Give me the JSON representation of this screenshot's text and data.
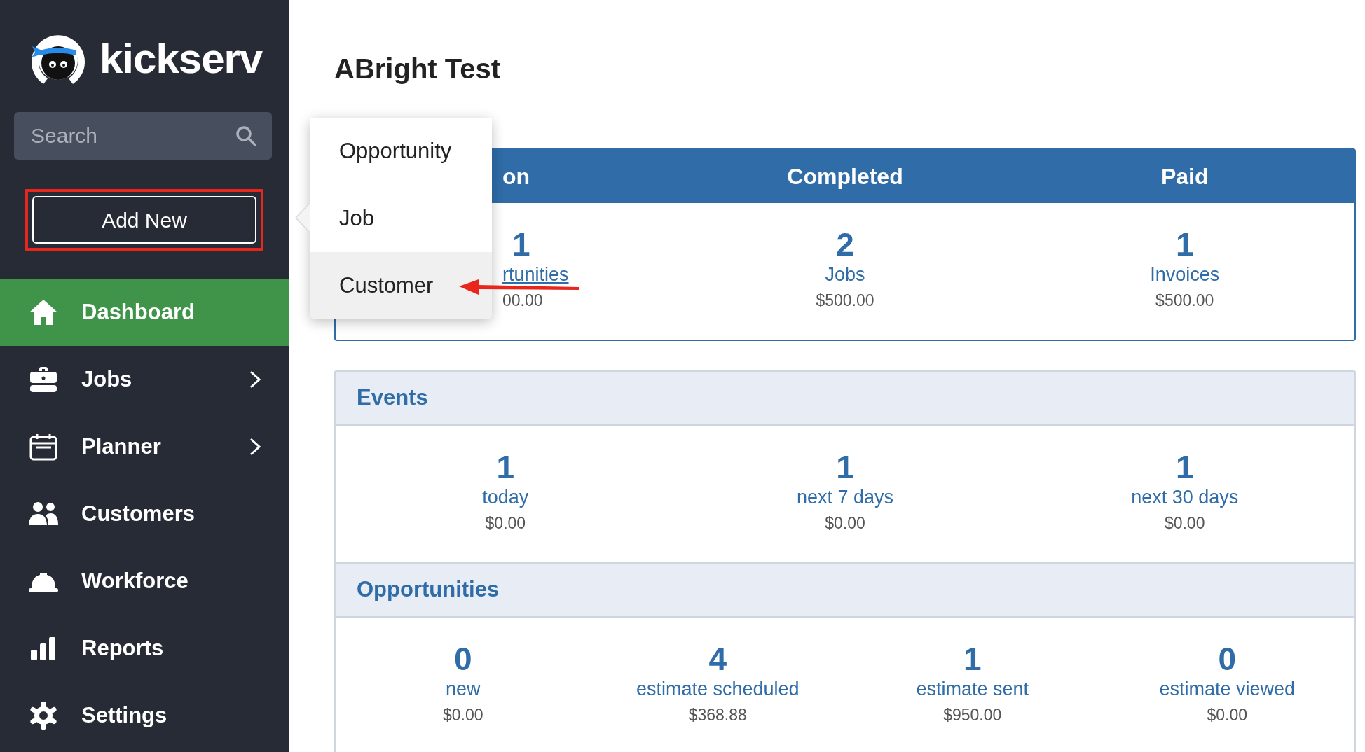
{
  "sidebar": {
    "logo_text": "kickserv",
    "search": {
      "placeholder": "Search"
    },
    "add_button": {
      "label": "Add New",
      "highlighted": true
    },
    "nav": [
      {
        "label": "Dashboard",
        "selected": true,
        "has_submenu": false
      },
      {
        "label": "Jobs",
        "selected": false,
        "has_submenu": true
      },
      {
        "label": "Planner",
        "selected": false,
        "has_submenu": true
      },
      {
        "label": "Customers",
        "selected": false,
        "has_submenu": false
      },
      {
        "label": "Workforce",
        "selected": false,
        "has_submenu": false
      },
      {
        "label": "Reports",
        "selected": false,
        "has_submenu": false
      },
      {
        "label": "Settings",
        "selected": false,
        "has_submenu": false
      }
    ]
  },
  "page": {
    "title": "ABright Test"
  },
  "summary_card": {
    "columns": [
      {
        "kind": "partial",
        "header": "on",
        "count": "1",
        "label": "rtunities",
        "amount": "00.00"
      },
      {
        "kind": "full",
        "header": "Completed",
        "count": "2",
        "label": "Jobs",
        "amount": "$500.00"
      },
      {
        "kind": "full",
        "header": "Paid",
        "count": "1",
        "label": "Invoices",
        "amount": "$500.00"
      }
    ]
  },
  "sections": [
    {
      "title": "Events",
      "stats": [
        {
          "count": "1",
          "label": "today",
          "amount": "$0.00"
        },
        {
          "count": "1",
          "label": "next 7 days",
          "amount": "$0.00"
        },
        {
          "count": "1",
          "label": "next 30 days",
          "amount": "$0.00"
        }
      ]
    },
    {
      "title": "Opportunities",
      "stats": [
        {
          "count": "0",
          "label": "new",
          "amount": "$0.00"
        },
        {
          "count": "4",
          "label": "estimate scheduled",
          "amount": "$368.88"
        },
        {
          "count": "1",
          "label": "estimate sent",
          "amount": "$950.00"
        },
        {
          "count": "0",
          "label": "estimate viewed",
          "amount": "$0.00"
        }
      ]
    }
  ],
  "popover": {
    "items": [
      {
        "label": "Opportunity",
        "selected": false
      },
      {
        "label": "Job",
        "selected": false
      },
      {
        "label": "Customer",
        "selected": true
      }
    ],
    "arrow_annotation": true
  }
}
